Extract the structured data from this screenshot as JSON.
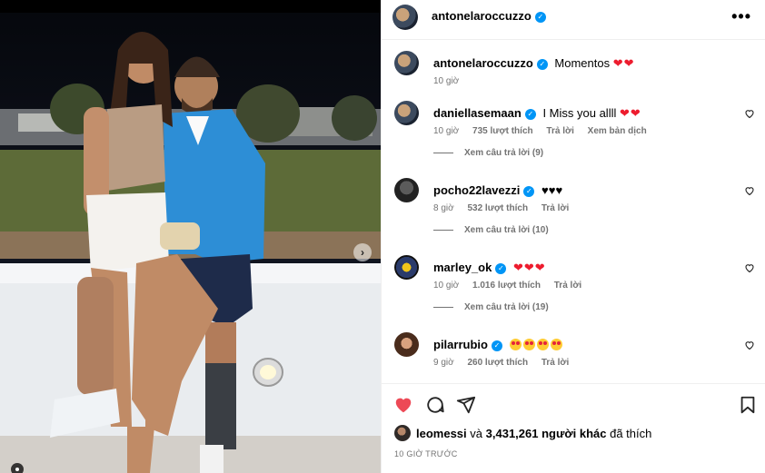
{
  "post": {
    "author": "antonelaroccuzzo",
    "more_label": "•••",
    "caption": {
      "username": "antonelaroccuzzo",
      "text": "Momentos",
      "hearts": "❤❤",
      "time": "10 giờ"
    }
  },
  "comments": [
    {
      "username": "daniellasemaan",
      "verified": true,
      "text": "I Miss you allll",
      "hearts": "❤❤",
      "time": "10 giờ",
      "likes": "735 lượt thích",
      "reply": "Trả lời",
      "translate": "Xem bản dịch",
      "replies": "Xem câu trả lời (9)"
    },
    {
      "username": "pocho22lavezzi",
      "verified": true,
      "text": "♥♥♥",
      "hearts": "",
      "time": "8 giờ",
      "likes": "532 lượt thích",
      "reply": "Trả lời",
      "translate": "",
      "replies": "Xem câu trả lời (10)"
    },
    {
      "username": "marley_ok",
      "verified": true,
      "text": "",
      "hearts": "❤❤❤",
      "time": "10 giờ",
      "likes": "1.016 lượt thích",
      "reply": "Trả lời",
      "translate": "",
      "replies": "Xem câu trả lời (19)"
    },
    {
      "username": "pilarrubio",
      "verified": true,
      "text": "",
      "hearts": "",
      "emoji_count": 4,
      "time": "9 giờ",
      "likes": "260 lượt thích",
      "reply": "Trả lời",
      "translate": "",
      "replies": ""
    }
  ],
  "likes_summary": {
    "user": "leomessi",
    "connector": "và",
    "count": "3,431,261 người khác",
    "suffix": "đã thích"
  },
  "time_ago": "10 GIỜ TRƯỚC",
  "colors": {
    "like_red": "#ed4956",
    "verified_blue": "#0095f6",
    "meta_gray": "#737373"
  },
  "icons": [
    "heart-filled-icon",
    "comment-icon",
    "share-icon",
    "bookmark-icon",
    "verified-icon",
    "more-icon",
    "next-arrow-icon"
  ]
}
